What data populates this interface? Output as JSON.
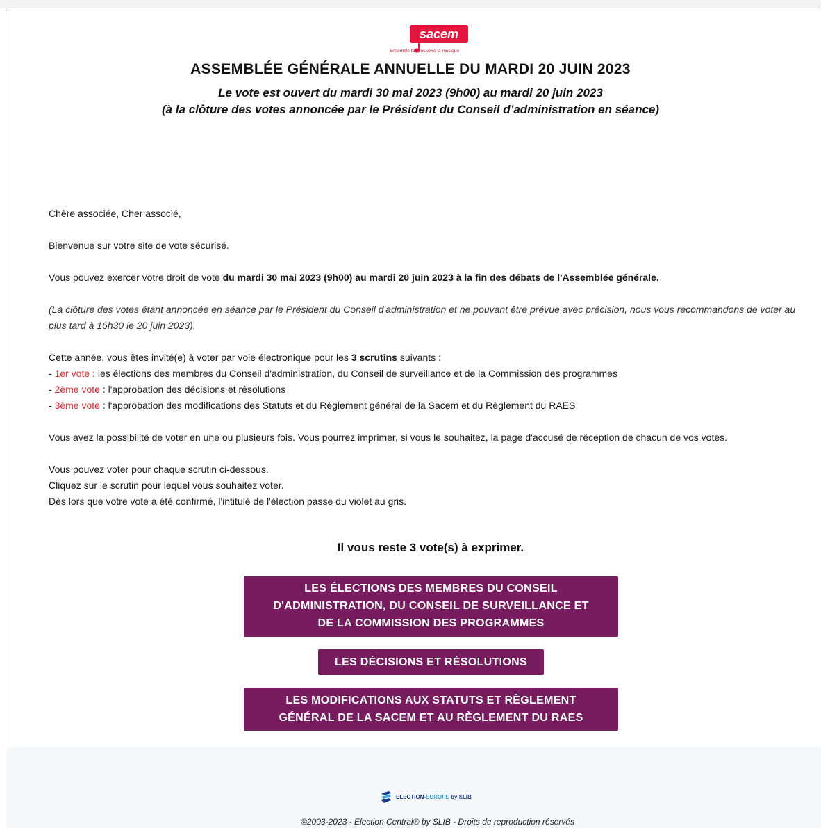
{
  "logo": {
    "name": "sacem",
    "tagline": "Ensemble faisons vivre la musique",
    "brand_color": "#e1173f"
  },
  "header": {
    "title": "ASSEMBLÉE GÉNÉRALE ANNUELLE DU MARDI 20 JUIN 2023",
    "subtitle_line1": "Le vote est ouvert du mardi 30 mai 2023 (9h00) au mardi 20 juin 2023",
    "subtitle_line2": "(à la clôture des votes annoncée par le Président du Conseil d’administration en séance)"
  },
  "body": {
    "greeting": "Chère associée, Cher associé,",
    "welcome": "Bienvenue sur votre site de vote sécurisé.",
    "period_prefix": "Vous pouvez exercer votre droit de vote ",
    "period_bold": "du mardi 30 mai 2023 (9h00) au mardi 20 juin 2023 à la fin des débats de l'Assemblée générale.",
    "closing_note": "(La clôture des votes étant annoncée en séance par le Président du Conseil d'administration et ne pouvant être prévue avec précision, nous vous recommandons de voter au plus tard à 16h30 le 20 juin 2023).",
    "intro_prefix": "Cette année, vous êtes invité(e) à voter par voie électronique pour les ",
    "intro_bold": "3 scrutins",
    "intro_suffix": " suivants :",
    "votes": [
      {
        "dash": "- ",
        "label": "1er vote",
        "sep": " : ",
        "text": "les élections des membres du Conseil d'administration, du Conseil de surveillance et de la Commission des programmes"
      },
      {
        "dash": "- ",
        "label": "2ème vote",
        "sep": " : ",
        "text": "l'approbation des décisions et résolutions"
      },
      {
        "dash": "- ",
        "label": "3ème vote",
        "sep": " : ",
        "text": "l'approbation des modifications des Statuts et du Règlement général de la Sacem et du Règlement du RAES"
      }
    ],
    "possibility": "Vous avez la possibilité de voter en une ou plusieurs fois. Vous pourrez imprimer, si vous le souhaitez, la page d'accusé de réception de chacun de vos votes.",
    "instr1": "Vous pouvez voter pour chaque scrutin ci-dessous.",
    "instr2": "Cliquez sur le scrutin pour lequel vous souhaitez voter.",
    "instr3": "Dès lors que votre vote a été confirmé, l'intitulé de l'élection passe du violet au gris."
  },
  "remaining": "Il vous reste 3 vote(s) à exprimer.",
  "buttons": {
    "b1_line1": "LES ÉLECTIONS DES MEMBRES DU CONSEIL",
    "b1_line2": "D'ADMINISTRATION, DU CONSEIL DE SURVEILLANCE ET",
    "b1_line3": "DE LA COMMISSION DES PROGRAMMES",
    "b2": "LES DÉCISIONS ET RÉSOLUTIONS",
    "b3_line1": "LES MODIFICATIONS AUX STATUTS ET RÈGLEMENT",
    "b3_line2": "GÉNÉRAL DE LA SACEM ET AU RÈGLEMENT DU RAES",
    "color": "#771c5f"
  },
  "footer": {
    "brand_main": "ELECTION-",
    "brand_accent": "EUROPE",
    "brand_suffix": " by SLIB",
    "copyright": "©2003-2023 - Election Central® by SLIB - Droits de reproduction réservés"
  }
}
